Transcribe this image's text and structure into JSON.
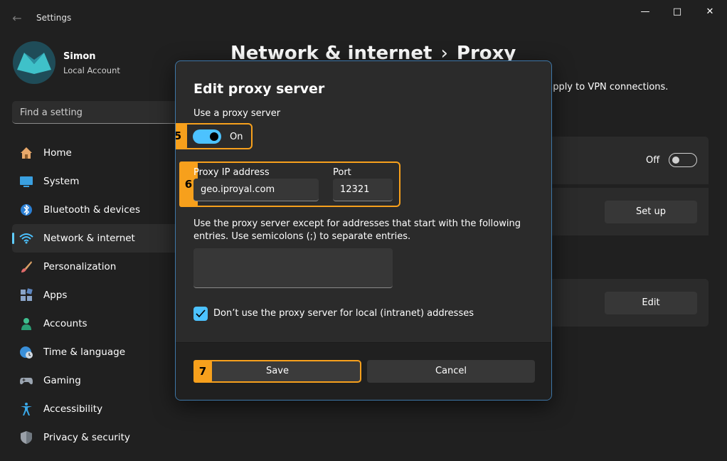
{
  "window": {
    "title": "Settings",
    "back_glyph": "←",
    "min_glyph": "—",
    "max_glyph": "□",
    "close_glyph": "✕"
  },
  "profile": {
    "name": "Simon",
    "account_type": "Local Account"
  },
  "search": {
    "placeholder": "Find a setting"
  },
  "nav": {
    "items": [
      {
        "label": "Home",
        "icon": "home-icon"
      },
      {
        "label": "System",
        "icon": "monitor-icon"
      },
      {
        "label": "Bluetooth & devices",
        "icon": "bluetooth-icon"
      },
      {
        "label": "Network & internet",
        "icon": "wifi-icon",
        "active": true
      },
      {
        "label": "Personalization",
        "icon": "brush-icon"
      },
      {
        "label": "Apps",
        "icon": "apps-icon"
      },
      {
        "label": "Accounts",
        "icon": "person-icon"
      },
      {
        "label": "Time & language",
        "icon": "globe-clock-icon"
      },
      {
        "label": "Gaming",
        "icon": "gamepad-icon"
      },
      {
        "label": "Accessibility",
        "icon": "accessibility-icon"
      },
      {
        "label": "Privacy & security",
        "icon": "shield-icon"
      }
    ]
  },
  "header": {
    "parent": "Network & internet",
    "separator": "›",
    "current": "Proxy"
  },
  "background": {
    "note": "t apply to VPN connections.",
    "off_label": "Off",
    "setup_label": "Set up",
    "edit_label": "Edit"
  },
  "dialog": {
    "title": "Edit proxy server",
    "use_proxy_label": "Use a proxy server",
    "toggle_state": "On",
    "ip_label": "Proxy IP address",
    "ip_value": "geo.iproyal.com",
    "port_label": "Port",
    "port_value": "12321",
    "exceptions_text": "Use the proxy server except for addresses that start with the following entries. Use semicolons (;) to separate entries.",
    "exceptions_value": "",
    "local_checkbox_label": "Don’t use the proxy server for local (intranet) addresses",
    "local_checkbox_checked": true,
    "save_label": "Save",
    "cancel_label": "Cancel"
  },
  "annotations": {
    "step5": "5",
    "step6": "6",
    "step7": "7"
  },
  "colors": {
    "accent": "#4cc2ff",
    "highlight": "#f7a01c",
    "dialog_border": "#3e77a8"
  }
}
